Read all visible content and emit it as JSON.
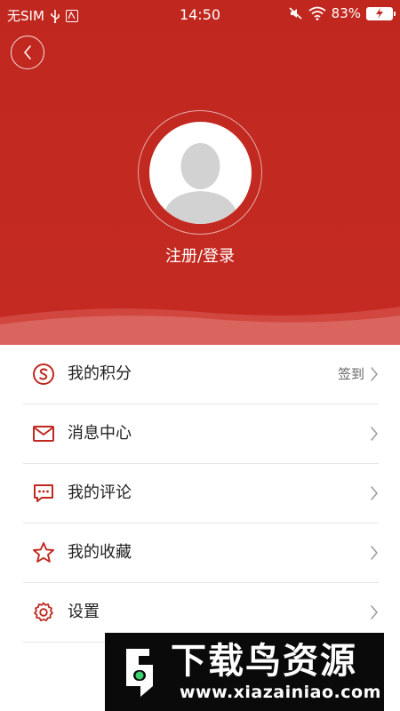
{
  "status_bar": {
    "carrier": "无SIM",
    "time": "14:50",
    "battery_pct": "83%"
  },
  "header": {
    "back_icon": "chevron-left-icon",
    "avatar_icon": "default-user-avatar",
    "login_label": "注册/登录",
    "bg_color": "#c0281f"
  },
  "menu": {
    "items": [
      {
        "label": "我的积分",
        "icon": "points-s-circle-icon",
        "extra": "签到"
      },
      {
        "label": "消息中心",
        "icon": "envelope-icon",
        "extra": ""
      },
      {
        "label": "我的评论",
        "icon": "comment-bubble-icon",
        "extra": ""
      },
      {
        "label": "我的收藏",
        "icon": "star-icon",
        "extra": ""
      },
      {
        "label": "设置",
        "icon": "gear-icon",
        "extra": ""
      }
    ],
    "accent_color": "#c0281f"
  },
  "watermark": {
    "title": "下载鸟资源",
    "url": "www.xiazainiao.com"
  }
}
